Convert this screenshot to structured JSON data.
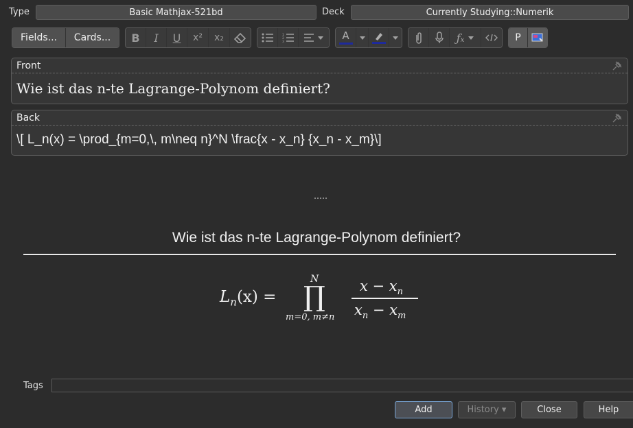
{
  "header": {
    "type_label": "Type",
    "type_value": "Basic Mathjax-521bd",
    "deck_label": "Deck",
    "deck_value": "Currently Studying::Numerik"
  },
  "toolbar": {
    "fields_label": "Fields...",
    "cards_label": "Cards...",
    "bold": "B",
    "italic": "I",
    "underline": "U",
    "superscript": "x²",
    "subscript": "x₂",
    "p_label": "P",
    "text_color": "#1e2a9c",
    "highlight_color": "#1e2a9c"
  },
  "fields": [
    {
      "name": "Front",
      "value": "Wie ist das n-te Lagrange-Polynom definiert?"
    },
    {
      "name": "Back",
      "value": "\\[ L_n(x) = \\prod_{m=0,\\, m\\neq n}^N \\frac{x - x_n} {x_n - x_m}\\]"
    }
  ],
  "preview": {
    "question": "Wie ist das n-te Lagrange-Polynom definiert?",
    "math": {
      "lhs": "L",
      "lhs_sub": "n",
      "lhs_arg": "(x) =",
      "prod_upper": "N",
      "prod_lower": "m=0, m≠n",
      "numerator": "x − x",
      "numerator_sub": "n",
      "denominator": "x",
      "denominator_sub1": "n",
      "denominator_mid": " − x",
      "denominator_sub2": "m"
    }
  },
  "tags": {
    "label": "Tags",
    "value": ""
  },
  "buttons": {
    "add": "Add",
    "history": "History ▾",
    "close": "Close",
    "help": "Help"
  }
}
